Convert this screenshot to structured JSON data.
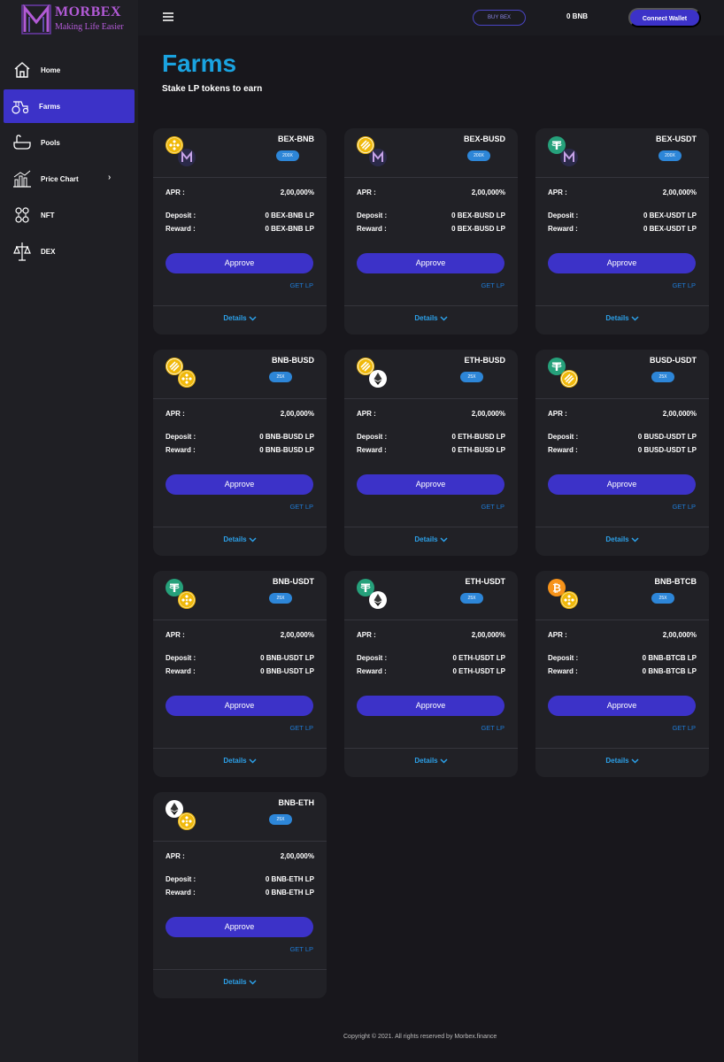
{
  "brand": {
    "name": "MORBEX",
    "tagline": "Making Life Easier"
  },
  "sidebar": {
    "items": [
      {
        "label": "Home",
        "icon": "home-icon",
        "active": false
      },
      {
        "label": "Farms",
        "icon": "tractor-icon",
        "active": true
      },
      {
        "label": "Pools",
        "icon": "bathtub-icon",
        "active": false
      },
      {
        "label": "Price Chart",
        "icon": "chart-icon",
        "active": false,
        "has_submenu": true
      },
      {
        "label": "NFT",
        "icon": "nft-icon",
        "active": false
      },
      {
        "label": "DEX",
        "icon": "dex-icon",
        "active": false
      }
    ]
  },
  "header": {
    "buy_label": "BUY BEX",
    "balance": "0 BNB",
    "connect_label": "Connect Wallet"
  },
  "page": {
    "title": "Farms",
    "subtitle": "Stake LP tokens to earn"
  },
  "labels": {
    "apr": "APR :",
    "deposit": "Deposit :",
    "reward": "Reward :",
    "approve": "Approve",
    "get_lp": "GET LP",
    "details": "Details"
  },
  "farms": [
    {
      "pair": "BEX-BNB",
      "multiplier": "200X",
      "apr": "2,00,000%",
      "deposit": "0 BEX-BNB LP",
      "reward": "0 BEX-BNB LP",
      "tokens": [
        "bnb",
        "morbex"
      ]
    },
    {
      "pair": "BEX-BUSD",
      "multiplier": "200X",
      "apr": "2,00,000%",
      "deposit": "0 BEX-BUSD LP",
      "reward": "0 BEX-BUSD LP",
      "tokens": [
        "busd",
        "morbex"
      ]
    },
    {
      "pair": "BEX-USDT",
      "multiplier": "200X",
      "apr": "2,00,000%",
      "deposit": "0 BEX-USDT LP",
      "reward": "0 BEX-USDT LP",
      "tokens": [
        "usdt",
        "morbex"
      ]
    },
    {
      "pair": "BNB-BUSD",
      "multiplier": "25X",
      "apr": "2,00,000%",
      "deposit": "0 BNB-BUSD LP",
      "reward": "0 BNB-BUSD LP",
      "tokens": [
        "busd",
        "bnb"
      ]
    },
    {
      "pair": "ETH-BUSD",
      "multiplier": "25X",
      "apr": "2,00,000%",
      "deposit": "0 ETH-BUSD LP",
      "reward": "0 ETH-BUSD LP",
      "tokens": [
        "busd",
        "eth"
      ]
    },
    {
      "pair": "BUSD-USDT",
      "multiplier": "25X",
      "apr": "2,00,000%",
      "deposit": "0 BUSD-USDT LP",
      "reward": "0 BUSD-USDT LP",
      "tokens": [
        "usdt",
        "busd"
      ]
    },
    {
      "pair": "BNB-USDT",
      "multiplier": "25X",
      "apr": "2,00,000%",
      "deposit": "0 BNB-USDT LP",
      "reward": "0 BNB-USDT LP",
      "tokens": [
        "usdt",
        "bnb"
      ]
    },
    {
      "pair": "ETH-USDT",
      "multiplier": "25X",
      "apr": "2,00,000%",
      "deposit": "0 ETH-USDT LP",
      "reward": "0 ETH-USDT LP",
      "tokens": [
        "usdt",
        "eth"
      ]
    },
    {
      "pair": "BNB-BTCB",
      "multiplier": "25X",
      "apr": "2,00,000%",
      "deposit": "0 BNB-BTCB LP",
      "reward": "0 BNB-BTCB LP",
      "tokens": [
        "btc",
        "bnb"
      ]
    },
    {
      "pair": "BNB-ETH",
      "multiplier": "25X",
      "apr": "2,00,000%",
      "deposit": "0 BNB-ETH LP",
      "reward": "0 BNB-ETH LP",
      "tokens": [
        "eth",
        "bnb"
      ]
    }
  ],
  "footer": {
    "text": "Copyright © 2021. All rights reserved by Morbex.finance"
  },
  "colors": {
    "accent": "#3c32c8",
    "title": "#1aa3e0",
    "link": "#1f7ad4",
    "multiplier": "#2d86d8",
    "card": "#212126",
    "background": "#18171c"
  }
}
